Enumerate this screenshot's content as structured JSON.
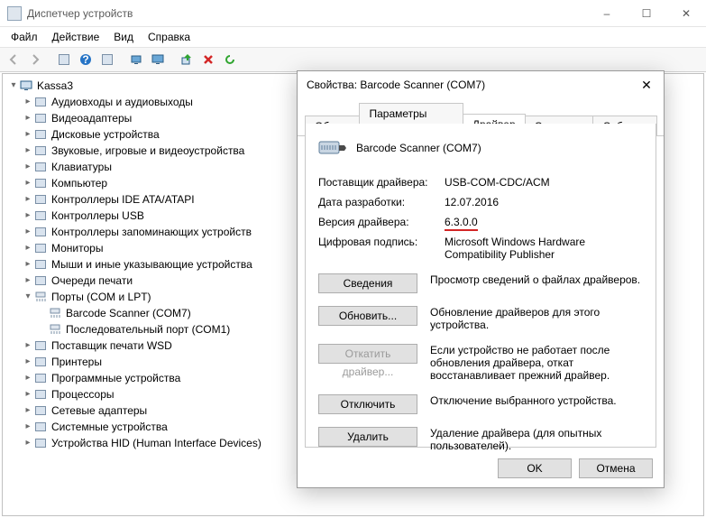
{
  "window": {
    "title": "Диспетчер устройств",
    "buttons": {
      "min": "–",
      "max": "☐",
      "close": "✕"
    }
  },
  "menubar": [
    "Файл",
    "Действие",
    "Вид",
    "Справка"
  ],
  "toolbar_icons": [
    "nav-back",
    "nav-fwd",
    "show-tree",
    "help",
    "properties",
    "monitor-small",
    "monitor-large",
    "green-plus",
    "red-x",
    "refresh"
  ],
  "tree": {
    "root": "Kassa3",
    "items": [
      "Аудиовходы и аудиовыходы",
      "Видеоадаптеры",
      "Дисковые устройства",
      "Звуковые, игровые и видеоустройства",
      "Клавиатуры",
      "Компьютер",
      "Контроллеры IDE ATA/ATAPI",
      "Контроллеры USB",
      "Контроллеры запоминающих устройств",
      "Мониторы",
      "Мыши и иные указывающие устройства",
      "Очереди печати"
    ],
    "ports": {
      "label": "Порты (COM и LPT)",
      "children": [
        "Barcode Scanner (COM7)",
        "Последовательный порт (COM1)"
      ]
    },
    "items_after": [
      "Поставщик печати WSD",
      "Принтеры",
      "Программные устройства",
      "Процессоры",
      "Сетевые адаптеры",
      "Системные устройства",
      "Устройства HID (Human Interface Devices)"
    ]
  },
  "dialog": {
    "title": "Свойства: Barcode Scanner (COM7)",
    "tabs": [
      "Общие",
      "Параметры порта",
      "Драйвер",
      "Сведения",
      "События"
    ],
    "active_tab": 2,
    "device_name": "Barcode Scanner (COM7)",
    "rows": {
      "vendor_k": "Поставщик драйвера:",
      "vendor_v": "USB-COM-CDC/ACM",
      "date_k": "Дата разработки:",
      "date_v": "12.07.2016",
      "ver_k": "Версия драйвера:",
      "ver_v": "6.3.0.0",
      "sig_k": "Цифровая подпись:",
      "sig_v": "Microsoft Windows Hardware Compatibility Publisher"
    },
    "actions": {
      "details": {
        "label": "Сведения",
        "desc": "Просмотр сведений о файлах драйверов."
      },
      "update": {
        "label": "Обновить...",
        "desc": "Обновление драйверов для этого устройства."
      },
      "rollback": {
        "label": "Откатить драйвер...",
        "desc": "Если устройство не работает после обновления драйвера, откат восстанавливает прежний драйвер."
      },
      "disable": {
        "label": "Отключить",
        "desc": "Отключение выбранного устройства."
      },
      "uninstall": {
        "label": "Удалить",
        "desc": "Удаление драйвера (для опытных пользователей)."
      }
    },
    "footer": {
      "ok": "OK",
      "cancel": "Отмена"
    }
  }
}
